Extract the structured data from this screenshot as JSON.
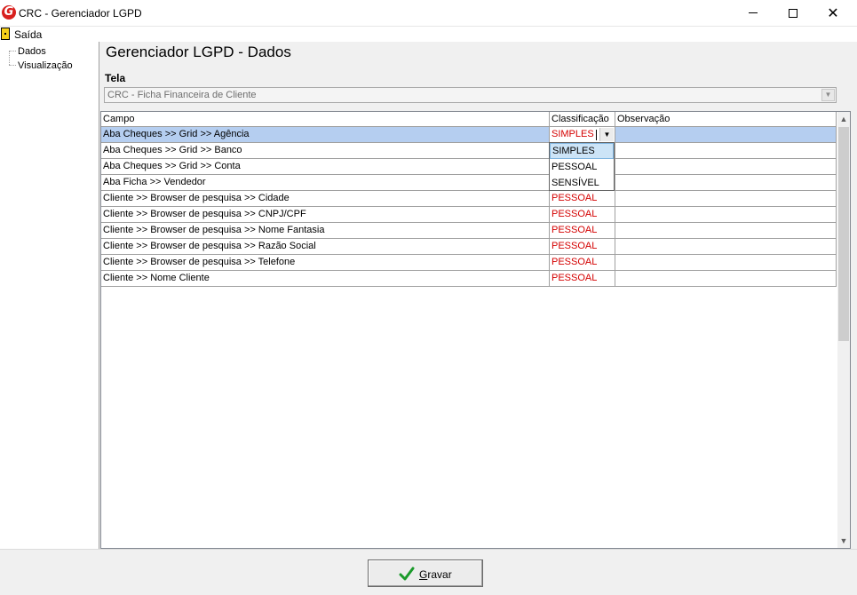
{
  "window": {
    "title": "CRC - Gerenciador LGPD"
  },
  "menu": {
    "exit_label": "Saída"
  },
  "tree": {
    "items": [
      "Dados",
      "Visualização"
    ]
  },
  "page": {
    "title": "Gerenciador LGPD - Dados",
    "screen_label": "Tela"
  },
  "screen_combo": {
    "value": "CRC - Ficha Financeira de Cliente"
  },
  "grid": {
    "columns": [
      "Campo",
      "Classificação",
      "Observação"
    ],
    "rows": [
      {
        "campo": "Aba Cheques >> Grid >> Agência",
        "classificacao": "SIMPLES",
        "observacao": ""
      },
      {
        "campo": "Aba Cheques >> Grid >> Banco",
        "classificacao": "",
        "observacao": ""
      },
      {
        "campo": "Aba Cheques >> Grid >> Conta",
        "classificacao": "",
        "observacao": ""
      },
      {
        "campo": "Aba Ficha >> Vendedor",
        "classificacao": "",
        "observacao": ""
      },
      {
        "campo": "Cliente >> Browser de pesquisa >> Cidade",
        "classificacao": "PESSOAL",
        "observacao": ""
      },
      {
        "campo": "Cliente >> Browser de pesquisa >> CNPJ/CPF",
        "classificacao": "PESSOAL",
        "observacao": ""
      },
      {
        "campo": "Cliente >> Browser de pesquisa >> Nome Fantasia",
        "classificacao": "PESSOAL",
        "observacao": ""
      },
      {
        "campo": "Cliente >> Browser de pesquisa >> Razão Social",
        "classificacao": "PESSOAL",
        "observacao": ""
      },
      {
        "campo": "Cliente >> Browser de pesquisa >> Telefone",
        "classificacao": "PESSOAL",
        "observacao": ""
      },
      {
        "campo": "Cliente >> Nome Cliente",
        "classificacao": "PESSOAL",
        "observacao": ""
      }
    ],
    "selected_row": 0
  },
  "classification_dropdown": {
    "options": [
      "SIMPLES",
      "PESSOAL",
      "SENSÍVEL"
    ],
    "highlighted": "SIMPLES"
  },
  "footer": {
    "save_label_underlined": "G",
    "save_label_rest": "ravar"
  },
  "colors": {
    "selection": "#b5cef0",
    "classification_text": "#d40000",
    "check": "#1a9a2a"
  }
}
